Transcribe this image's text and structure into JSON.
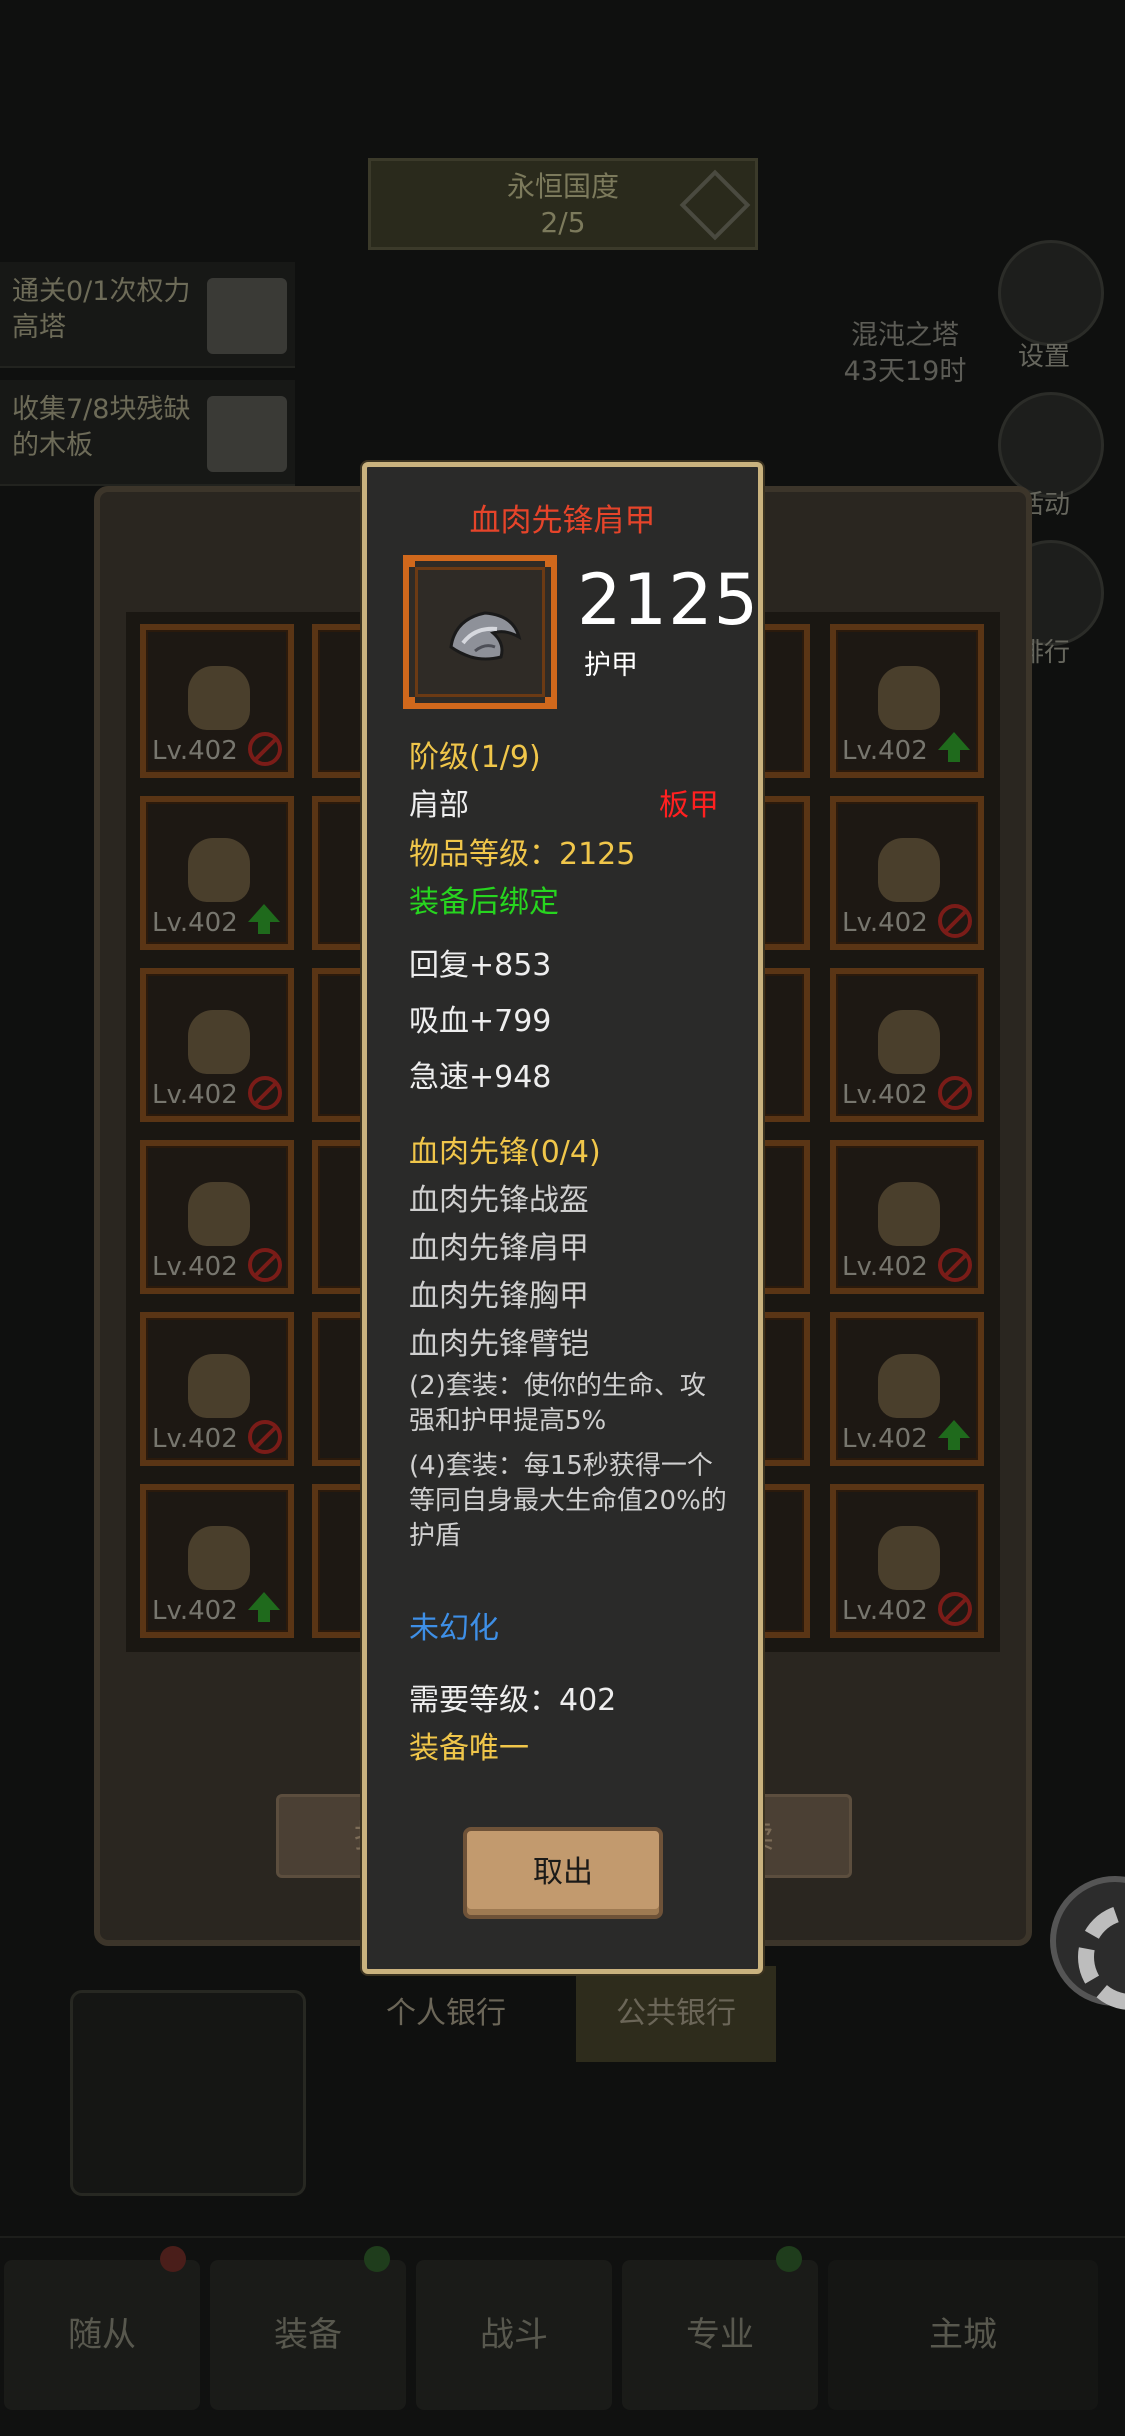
{
  "background": {
    "season": {
      "line1": "永恒国度",
      "line2": "2/5"
    },
    "quests": [
      {
        "text": "通关0/1次权力高塔"
      },
      {
        "text": "收集7/8块残缺的木板"
      }
    ],
    "tower": {
      "name": "混沌之塔",
      "time": "43天19时"
    },
    "side_labels": {
      "settings": "设置",
      "activity": "活动",
      "rank": "排行"
    },
    "grid_level": "Lv.402",
    "batch_left": "批量",
    "batch_right": "出卖",
    "bank_personal": "个人银行",
    "bank_public": "公共银行",
    "nav": [
      "随从",
      "装备",
      "战斗",
      "专业",
      "主城"
    ]
  },
  "dialog": {
    "title": "血肉先锋肩甲",
    "stat_value": "2125",
    "stat_label": "护甲",
    "tier": "阶级(1/9)",
    "slot": "肩部",
    "armor_type": "板甲",
    "item_level": "物品等级：2125",
    "bind": "装备后绑定",
    "stats": [
      "回复+853",
      "吸血+799",
      "急速+948"
    ],
    "set_name": "血肉先锋(0/4)",
    "set_items": [
      "血肉先锋战盔",
      "血肉先锋肩甲",
      "血肉先锋胸甲",
      "血肉先锋臂铠"
    ],
    "set_bonus_2": "(2)套装：使你的生命、攻强和护甲提高5%",
    "set_bonus_4": "(4)套装：每15秒获得一个等同自身最大生命值20%的护盾",
    "transmog": "未幻化",
    "req_level": "需要等级：402",
    "unique": "装备唯一",
    "exit_button": "取出"
  },
  "colors": {
    "title": "#e6442a",
    "yellow": "#f0c64a",
    "green": "#27d51f",
    "blue": "#3e8fe6",
    "red": "#ff2020"
  }
}
